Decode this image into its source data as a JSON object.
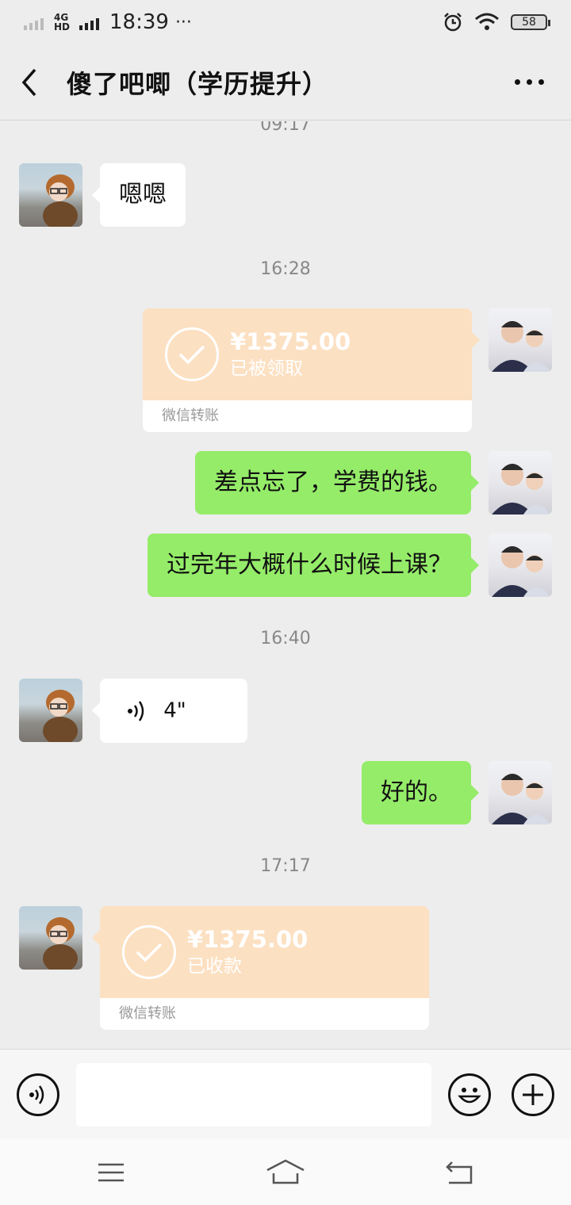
{
  "status_bar": {
    "network": "4G HD",
    "time": "18:39",
    "more": "···",
    "battery": "58"
  },
  "header": {
    "title": "傻了吧唧（学历提升）"
  },
  "messages": {
    "ts0": "09:17",
    "m1_text": "嗯嗯",
    "ts1": "16:28",
    "t1_amount": "¥1375.00",
    "t1_status": "已被领取",
    "t1_label": "微信转账",
    "m2_text": "差点忘了，学费的钱。",
    "m3_text": "过完年大概什么时候上课？",
    "ts2": "16:40",
    "voice_duration": "4\"",
    "m4_text": "好的。",
    "ts3": "17:17",
    "t2_amount": "¥1375.00",
    "t2_status": "已收款",
    "t2_label": "微信转账"
  },
  "input": {
    "value": "",
    "placeholder": ""
  },
  "icons": {
    "back": "chevron-left-icon",
    "more": "more-dots-icon",
    "voice": "voice-icon",
    "emoji": "emoji-icon",
    "plus": "plus-icon",
    "menu": "menu-icon",
    "home": "home-icon",
    "return": "back-arrow-icon"
  }
}
